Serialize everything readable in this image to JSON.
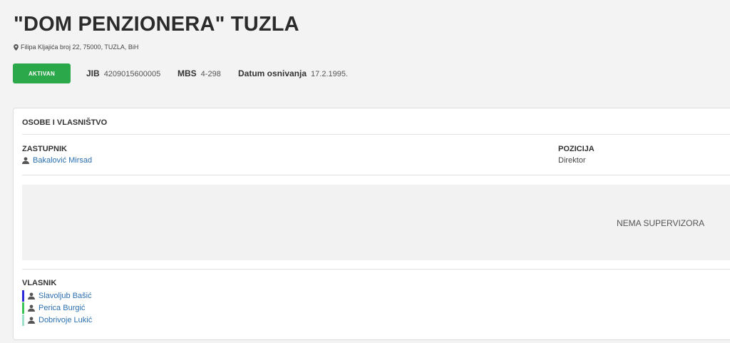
{
  "company": {
    "title": "\"DOM PENZIONERA\" TUZLA",
    "address": "Filipa Kljajića broj 22, 75000, TUZLA, BiH",
    "status": "AKTIVAN",
    "status_color": "#2aa84a",
    "jib_label": "JIB",
    "jib": "4209015600005",
    "mbs_label": "MBS",
    "mbs": "4-298",
    "founded_label": "Datum osnivanja",
    "founded": "17.2.1995."
  },
  "section": {
    "title": "OSOBE I VLASNIŠTVO",
    "representative_label": "ZASTUPNIK",
    "representative_name": "Bakalović Mirsad",
    "position_label": "POZICIJA",
    "position_value": "Direktor",
    "supervisors_empty": "NEMA SUPERVIZORA",
    "owner_label": "VLASNIK",
    "owners": [
      {
        "name": "Slavoljub Bašić",
        "color": "#2a2adb"
      },
      {
        "name": "Perica Burgić",
        "color": "#3cc45a"
      },
      {
        "name": "Dobrivoje Lukić",
        "color": "#9fe0c8"
      }
    ]
  },
  "icons": {
    "address": "map-pin-icon",
    "person": "user-icon"
  }
}
